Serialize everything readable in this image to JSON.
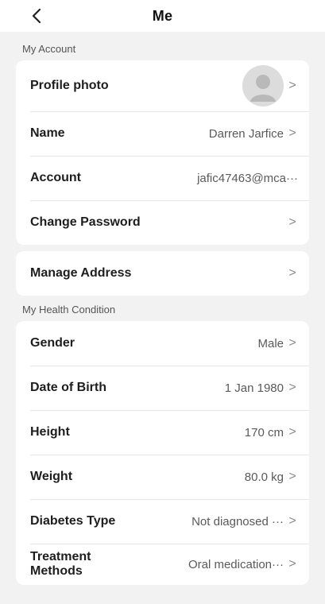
{
  "header": {
    "title": "Me",
    "back_icon": "chevron-left-icon"
  },
  "account": {
    "section_label": "My Account",
    "rows": [
      {
        "label": "Profile photo",
        "value": "",
        "icon": "avatar-placeholder-icon"
      },
      {
        "label": "Name",
        "value": "Darren Jarfice"
      },
      {
        "label": "Account",
        "value": "jafic47463@mca···"
      },
      {
        "label": "Change Password",
        "value": ""
      }
    ]
  },
  "address": {
    "label": "Manage Address"
  },
  "health": {
    "section_label": "My Health Condition",
    "rows": [
      {
        "label": "Gender",
        "value": "Male"
      },
      {
        "label": "Date of Birth",
        "value": "1 Jan 1980"
      },
      {
        "label": "Height",
        "value": "170 cm"
      },
      {
        "label": "Weight",
        "value": "80.0 kg"
      },
      {
        "label": "Diabetes Type",
        "value": "Not diagnosed ···"
      },
      {
        "label": "Treatment Methods",
        "value": "Oral medication···"
      }
    ]
  },
  "chevron_glyph": ">"
}
